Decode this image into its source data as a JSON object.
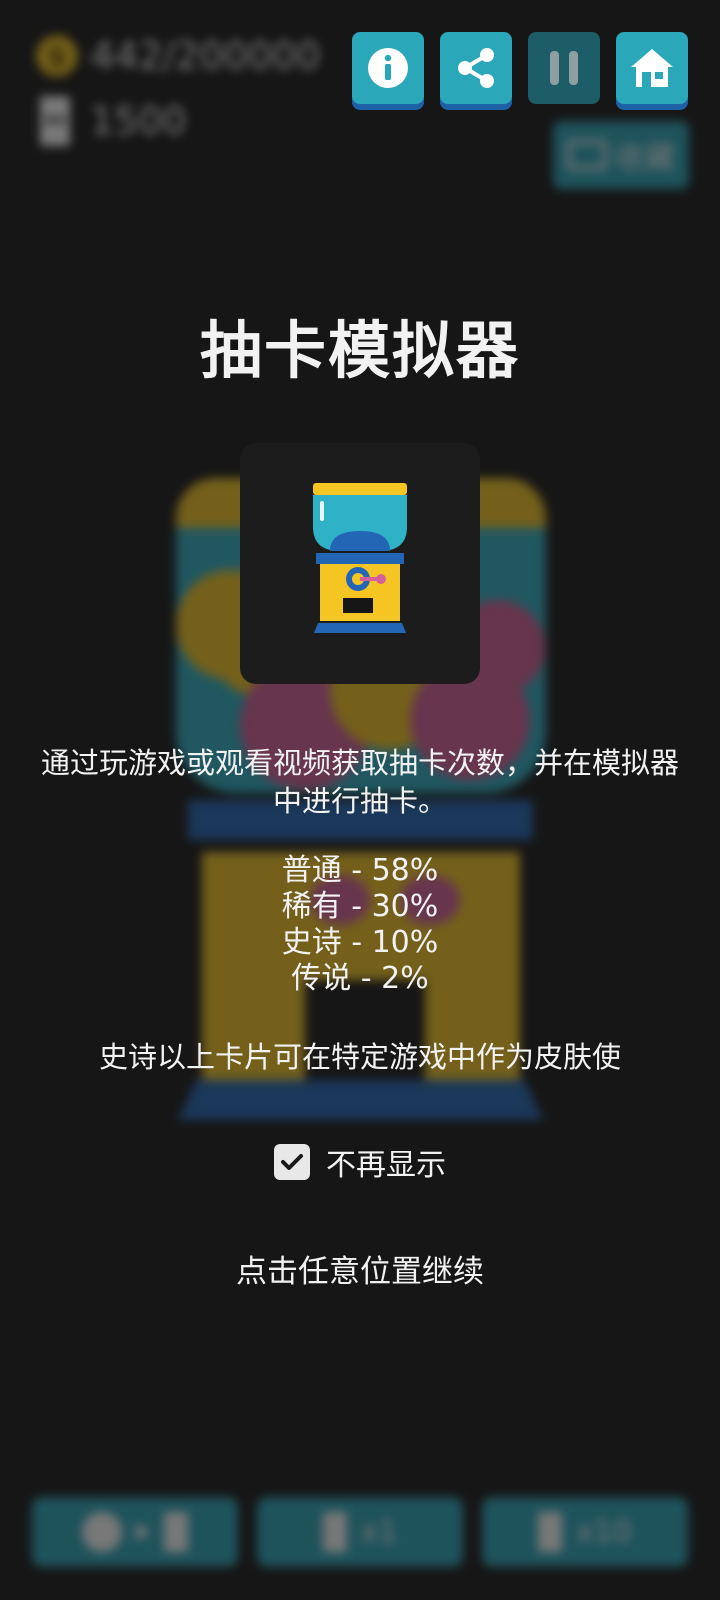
{
  "hud": {
    "coins": "442/200000",
    "tickets": "1500",
    "collection_label": "收藏"
  },
  "top_buttons": {
    "info": "info-icon",
    "share": "share-icon",
    "pause": "pause-icon",
    "home": "home-icon"
  },
  "dialog": {
    "title": "抽卡模拟器",
    "description": "通过玩游戏或观看视频获取抽卡次数，并在模拟器中进行抽卡。",
    "rates": [
      "普通 - 58%",
      "稀有 - 30%",
      "史诗 - 10%",
      "传说 - 2%"
    ],
    "note": "史诗以上卡片可在特定游戏中作为皮肤使",
    "dont_show_again": "不再显示",
    "dont_show_checked": true,
    "continue_hint": "点击任意位置继续"
  },
  "bottom_bar": {
    "draw_one": "x1",
    "draw_ten": "x10"
  },
  "colors": {
    "accent": "#2aa7b9",
    "accent_shadow": "#1d62a8",
    "gold": "#f5c623",
    "blue": "#2266b5"
  }
}
